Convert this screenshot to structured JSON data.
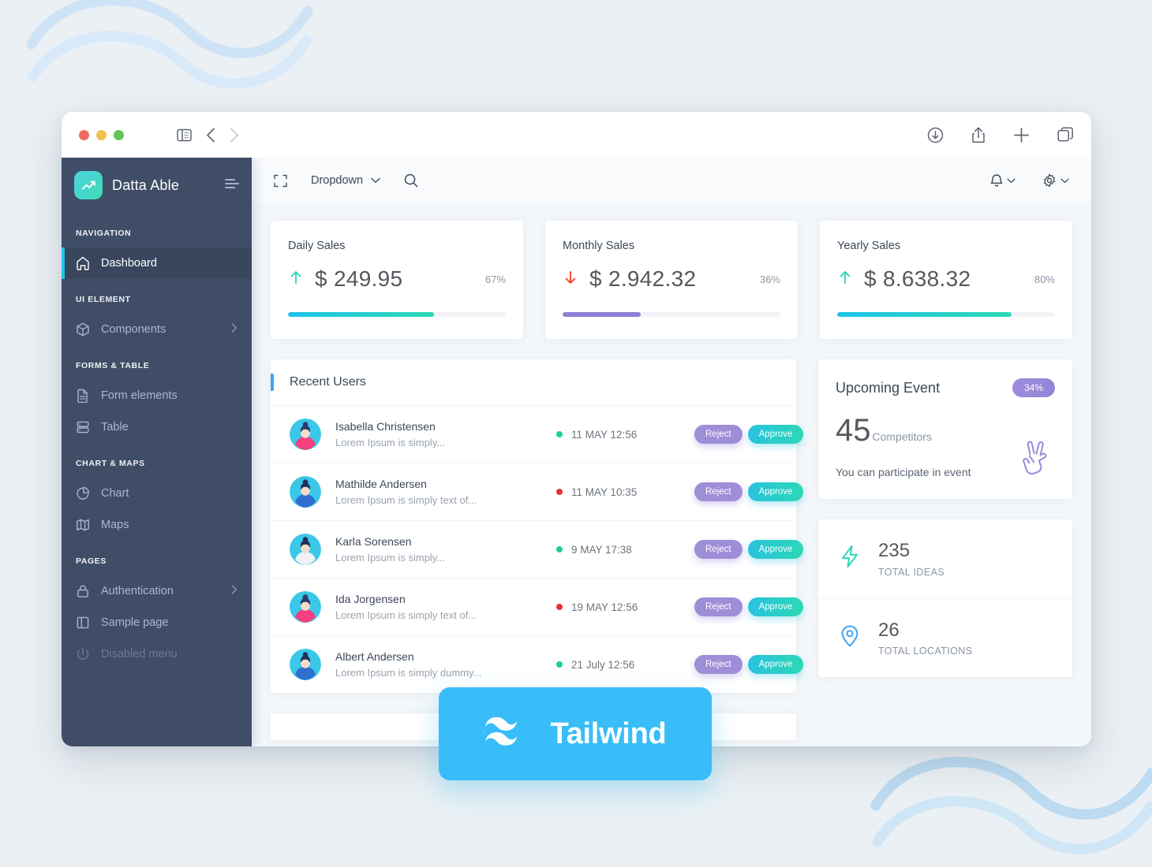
{
  "browser": {
    "controls": {
      "close": "close-traffic-light",
      "minimize": "minimize-traffic-light",
      "maximize": "maximize-traffic-light"
    },
    "nav": {
      "sidebar_toggle": "sidebar-toggle-icon",
      "back": "back-arrow-icon",
      "forward": "forward-arrow-icon"
    },
    "actions": {
      "download": "download-icon",
      "share": "share-icon",
      "new_tab": "plus-icon",
      "tabs": "tabs-icon"
    }
  },
  "sidebar": {
    "brand_name": "Datta Able",
    "brand_logo": "trending-up-icon",
    "collapse_icon": "menu-collapse-icon",
    "groups": [
      {
        "caption": "NAVIGATION",
        "items": [
          {
            "label": "Dashboard",
            "icon": "home-icon",
            "active": true,
            "disabled": false,
            "chevron": false
          }
        ]
      },
      {
        "caption": "UI ELEMENT",
        "items": [
          {
            "label": "Components",
            "icon": "box-icon",
            "active": false,
            "disabled": false,
            "chevron": true
          }
        ]
      },
      {
        "caption": "FORMS & TABLE",
        "items": [
          {
            "label": "Form elements",
            "icon": "file-icon",
            "active": false,
            "disabled": false,
            "chevron": false
          },
          {
            "label": "Table",
            "icon": "table-icon",
            "active": false,
            "disabled": false,
            "chevron": false
          }
        ]
      },
      {
        "caption": "CHART & MAPS",
        "items": [
          {
            "label": "Chart",
            "icon": "pie-chart-icon",
            "active": false,
            "disabled": false,
            "chevron": false
          },
          {
            "label": "Maps",
            "icon": "map-icon",
            "active": false,
            "disabled": false,
            "chevron": false
          }
        ]
      },
      {
        "caption": "PAGES",
        "items": [
          {
            "label": "Authentication",
            "icon": "lock-icon",
            "active": false,
            "disabled": false,
            "chevron": true
          },
          {
            "label": "Sample page",
            "icon": "sidebar-layout-icon",
            "active": false,
            "disabled": false,
            "chevron": false
          },
          {
            "label": "Disabled menu",
            "icon": "power-icon",
            "active": false,
            "disabled": true,
            "chevron": false
          }
        ]
      }
    ]
  },
  "topbar": {
    "fullscreen_icon": "fullscreen-icon",
    "dropdown_label": "Dropdown",
    "dropdown_chevron": "chevron-down-icon",
    "search_icon": "search-icon",
    "notification_icon": "bell-icon",
    "settings_icon": "gear-icon"
  },
  "stats": [
    {
      "title": "Daily Sales",
      "value": "$ 249.95",
      "percent": "67%",
      "progress": 67,
      "direction": "up",
      "arrow_icon": "arrow-up-icon",
      "arrow_color": "#2bd8b4",
      "bar_from": "#1dc4e9",
      "bar_to": "#2bd8b4"
    },
    {
      "title": "Monthly Sales",
      "value": "$ 2.942.32",
      "percent": "36%",
      "progress": 36,
      "direction": "down",
      "arrow_icon": "arrow-down-icon",
      "arrow_color": "#f44236",
      "bar_from": "#8e7fd6",
      "bar_to": "#8e7fd6"
    },
    {
      "title": "Yearly Sales",
      "value": "$ 8.638.32",
      "percent": "80%",
      "progress": 80,
      "direction": "up",
      "arrow_icon": "arrow-up-icon",
      "arrow_color": "#2bd8b4",
      "bar_from": "#1dc4e9",
      "bar_to": "#2bd8b4"
    }
  ],
  "recent_users": {
    "title": "Recent Users",
    "reject_label": "Reject",
    "approve_label": "Approve",
    "rows": [
      {
        "name": "Isabella Christensen",
        "note": "Lorem Ipsum is simply...",
        "time": "11 MAY 12:56",
        "status_color": "#1ece9c",
        "avatar_bg": "#3ac7e8",
        "avatar_hair": "#2b3a6b",
        "avatar_cloth": "#f4407f"
      },
      {
        "name": "Mathilde Andersen",
        "note": "Lorem Ipsum is simply text of...",
        "time": "11 MAY 10:35",
        "status_color": "#e8303a",
        "avatar_bg": "#3ac7e8",
        "avatar_hair": "#22305c",
        "avatar_cloth": "#2f6fd0"
      },
      {
        "name": "Karla Sorensen",
        "note": "Lorem Ipsum is simply...",
        "time": "9 MAY 17:38",
        "status_color": "#1ece9c",
        "avatar_bg": "#3ac7e8",
        "avatar_hair": "#232b52",
        "avatar_cloth": "#eef1f5"
      },
      {
        "name": "Ida Jorgensen",
        "note": "Lorem Ipsum is simply text of...",
        "time": "19 MAY 12:56",
        "status_color": "#e8303a",
        "avatar_bg": "#3ac7e8",
        "avatar_hair": "#2b3a6b",
        "avatar_cloth": "#f4407f"
      },
      {
        "name": "Albert Andersen",
        "note": "Lorem Ipsum is simply dummy...",
        "time": "21 July 12:56",
        "status_color": "#1ece9c",
        "avatar_bg": "#3ac7e8",
        "avatar_hair": "#22305c",
        "avatar_cloth": "#2f6fd0"
      }
    ]
  },
  "event_card": {
    "title": "Upcoming Event",
    "badge": "34%",
    "number": "45",
    "unit": "Competitors",
    "note": "You can participate in event",
    "icon": "peace-hand-icon",
    "icon_color": "#9e8ed8"
  },
  "mini_stats": [
    {
      "number": "235",
      "label": "TOTAL IDEAS",
      "icon": "lightning-bolt-icon",
      "color": "#2bd8b4"
    },
    {
      "number": "26",
      "label": "TOTAL LOCATIONS",
      "icon": "map-pin-icon",
      "color": "#3da5f4"
    }
  ],
  "tailwind_badge": {
    "label": "Tailwind",
    "icon": "tailwind-logo-icon",
    "bg_color": "#38bdf8"
  }
}
